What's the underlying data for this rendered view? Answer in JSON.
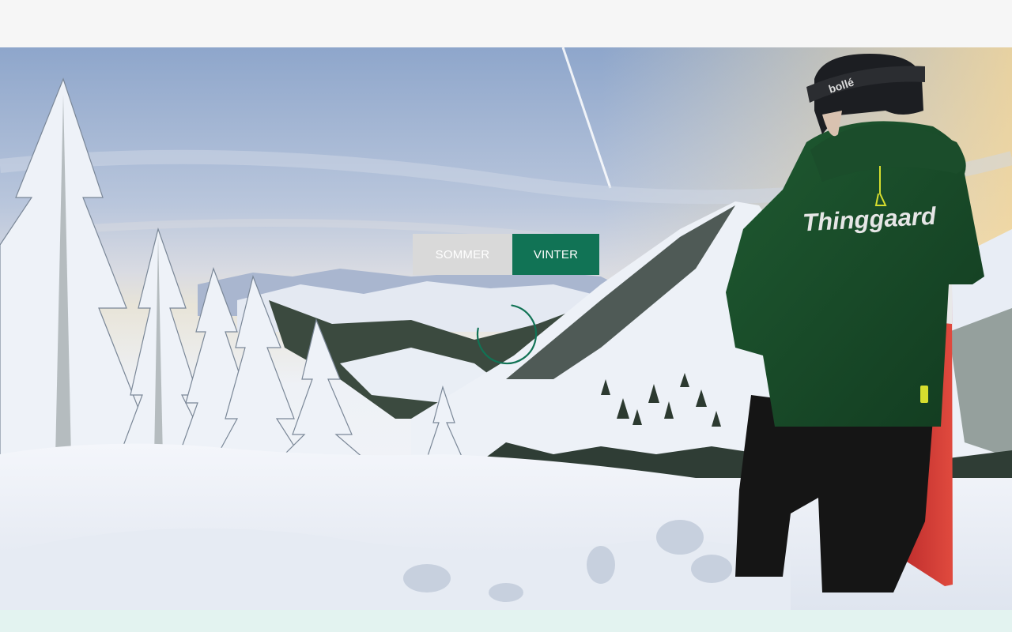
{
  "season_toggle": {
    "summer_label": "SOMMER",
    "winter_label": "VINTER",
    "selected": "VINTER"
  },
  "hero": {
    "jacket_brand": "Thinggaard",
    "helmet_brand": "bollé"
  },
  "colors": {
    "accent": "#117355",
    "inactive_button": "#d9d9d9",
    "top_bar": "#f6f6f6",
    "bottom_strip": "#e3f3f0"
  },
  "icons": {
    "loading": "loading-spinner-icon"
  }
}
